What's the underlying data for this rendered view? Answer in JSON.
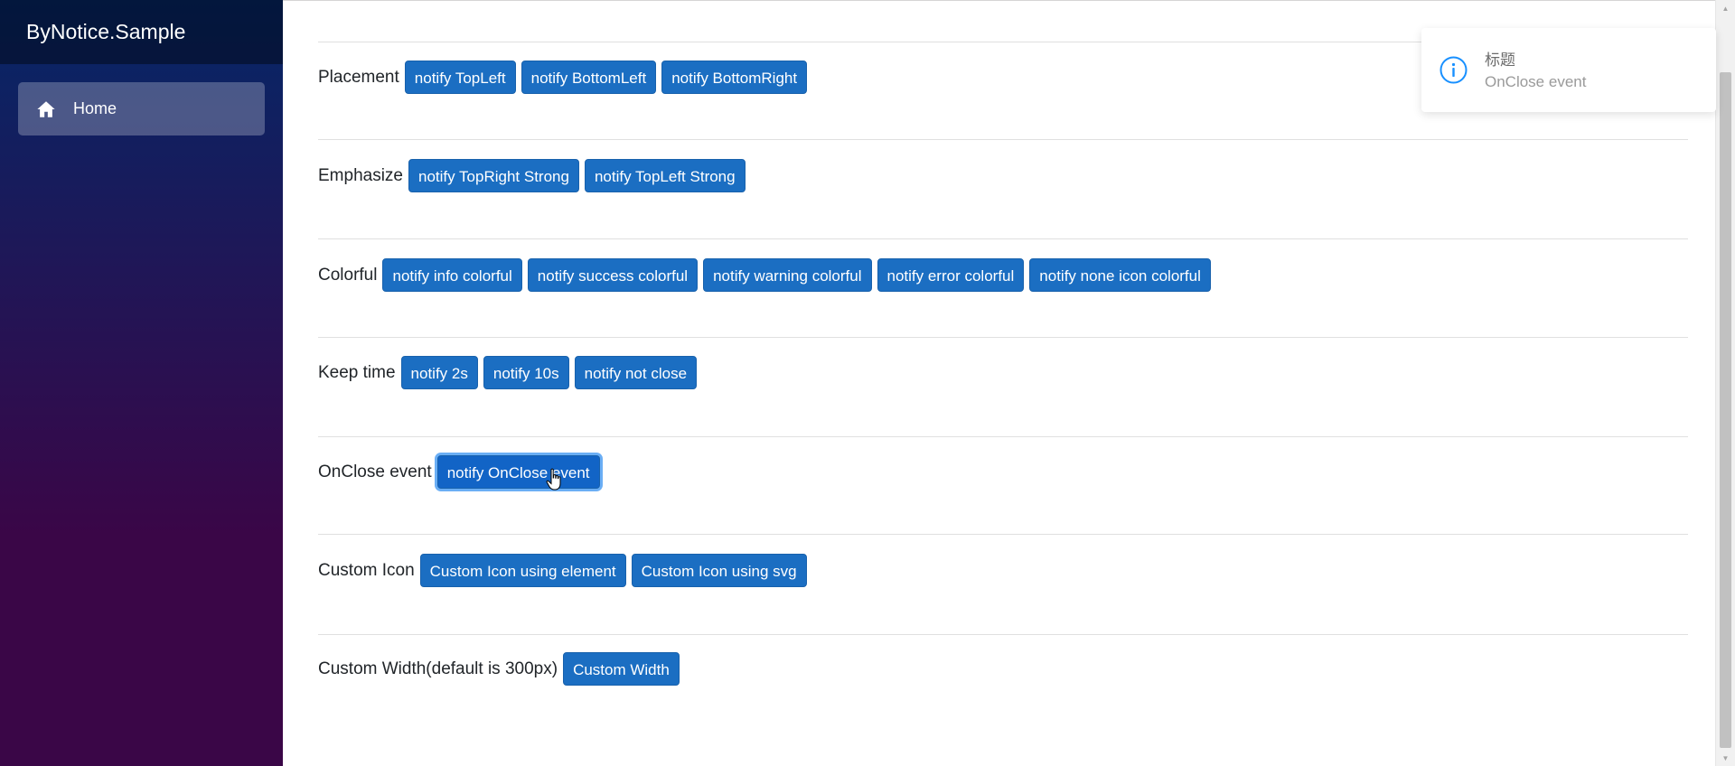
{
  "sidebar": {
    "brand": "ByNotice.Sample",
    "items": [
      {
        "label": "Home",
        "icon": "home-icon"
      }
    ]
  },
  "sections": [
    {
      "label": "Placement",
      "buttons": [
        "notify TopLeft",
        "notify BottomLeft",
        "notify BottomRight"
      ]
    },
    {
      "label": "Emphasize",
      "buttons": [
        "notify TopRight Strong",
        "notify TopLeft Strong"
      ]
    },
    {
      "label": "Colorful",
      "buttons": [
        "notify info colorful",
        "notify success colorful",
        "notify warning colorful",
        "notify error colorful",
        "notify none icon colorful"
      ]
    },
    {
      "label": "Keep time",
      "buttons": [
        "notify 2s",
        "notify 10s",
        "notify not close"
      ]
    },
    {
      "label": "OnClose event",
      "buttons": [
        "notify OnClose event"
      ]
    },
    {
      "label": "Custom Icon",
      "buttons": [
        "Custom Icon using element",
        "Custom Icon using svg"
      ]
    },
    {
      "label": "Custom Width(default is 300px)",
      "buttons": [
        "Custom Width"
      ]
    }
  ],
  "notification": {
    "title": "标题",
    "message": "OnClose event",
    "icon": "info-icon"
  },
  "colors": {
    "button": "#1b6ec2",
    "sidebar_top": "#052767",
    "sidebar_bottom": "#3a0647",
    "info_icon": "#1890ff"
  }
}
